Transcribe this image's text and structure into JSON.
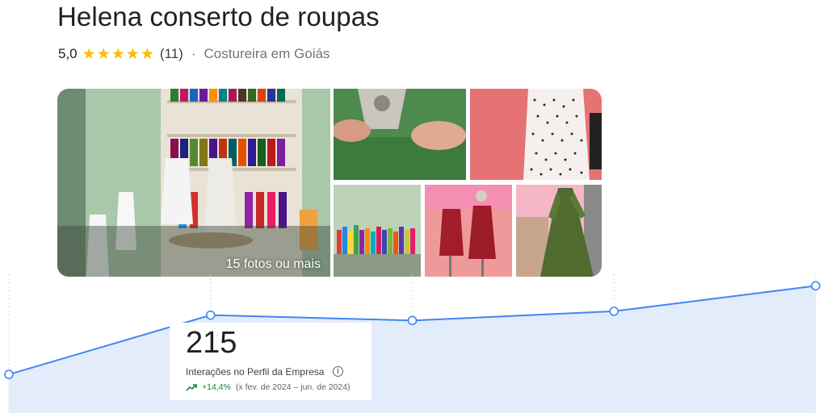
{
  "business": {
    "name": "Helena conserto de roupas",
    "rating": "5,0",
    "stars": [
      "★",
      "★",
      "★",
      "★",
      "★"
    ],
    "review_count": "(11)",
    "separator": "·",
    "category": "Costureira em Goiás"
  },
  "photos": {
    "more_label": "15 fotos ou mais",
    "tiles": [
      "sewing-room-thread-photo",
      "sewing-machine-photo",
      "polka-dot-dress-photo",
      "thread-shelf-photo",
      "red-dress-mannequins-photo",
      "green-dress-photo"
    ]
  },
  "metric_card": {
    "value": "215",
    "label": "Interações no Perfil da Empresa",
    "info_icon": "i",
    "trend_value": "+14,4%",
    "trend_period": "(x fev. de 2024 – jun. de 2024)",
    "trend_color": "#188038"
  },
  "chart_data": {
    "type": "area",
    "values": [
      100,
      177,
      170,
      182,
      215
    ],
    "ylim": [
      50,
      230
    ],
    "grid": "vertical dashed",
    "line_color": "#4285f4",
    "fill_color": "#e3ecfb"
  },
  "colors": {
    "star": "#fbbc04",
    "text_primary": "#202124",
    "text_secondary": "#70757a"
  }
}
